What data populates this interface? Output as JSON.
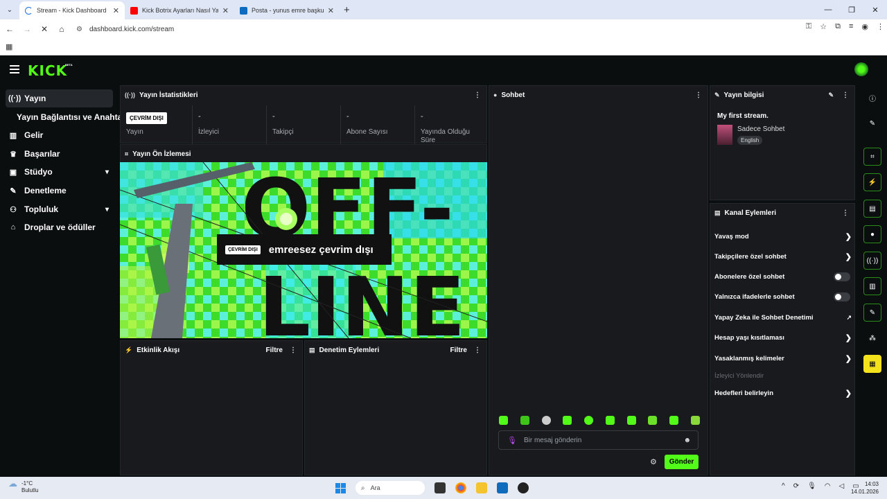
{
  "browser": {
    "tabs": [
      {
        "title": "Stream - Kick Dashboard",
        "active": true
      },
      {
        "title": "Kick Botrix Ayarları Nasıl Yapılır",
        "active": false
      },
      {
        "title": "Posta - yunus emre başkurt - O",
        "active": false
      }
    ],
    "url": "dashboard.kick.com/stream"
  },
  "header": {
    "logo": "KICK",
    "beta": "BETA"
  },
  "sidebar": {
    "items": [
      {
        "label": "Yayın",
        "icon": "broadcast-icon",
        "active": true
      },
      {
        "label": "Yayın Bağlantısı ve Anahtarı",
        "sub": true
      },
      {
        "label": "Gelir",
        "icon": "chart-icon"
      },
      {
        "label": "Başarılar",
        "icon": "trophy-icon"
      },
      {
        "label": "Stüdyo",
        "icon": "studio-icon",
        "expandable": true
      },
      {
        "label": "Denetleme",
        "icon": "wrench-icon"
      },
      {
        "label": "Topluluk",
        "icon": "people-icon",
        "expandable": true
      },
      {
        "label": "Droplar ve ödüller",
        "icon": "gift-icon"
      }
    ]
  },
  "stats": {
    "title": "Yayın İstatistikleri",
    "offline_badge": "ÇEVRİM DIŞI",
    "items": [
      {
        "value": "",
        "label": "Yayın"
      },
      {
        "value": "-",
        "label": "İzleyici"
      },
      {
        "value": "-",
        "label": "Takipçi"
      },
      {
        "value": "-",
        "label": "Abone Sayısı"
      },
      {
        "value": "-",
        "label": "Yayında Olduğu Süre"
      }
    ]
  },
  "preview": {
    "title": "Yayın Ön İzlemesi",
    "offline_tag": "ÇEVRİM DIŞI",
    "offline_msg": "emreesez çevrim dışı",
    "art_text_1": "OFF-",
    "art_text_2": "LINE"
  },
  "activity": {
    "title": "Etkinlik Akışı",
    "filter": "Filtre"
  },
  "modactions": {
    "title": "Denetim Eylemleri",
    "filter": "Filtre"
  },
  "chat": {
    "title": "Sohbet",
    "placeholder": "Bir mesaj gönderin",
    "send": "Gönder"
  },
  "streaminfo": {
    "title": "Yayın bilgisi",
    "stream_title": "My first stream.",
    "category": "Sadece Sohbet",
    "language": "English"
  },
  "channel_actions": {
    "title": "Kanal Eylemleri",
    "items": [
      {
        "label": "Yavaş mod",
        "control": "chevron"
      },
      {
        "label": "Takipçilere özel sohbet",
        "control": "chevron"
      },
      {
        "label": "Abonelere özel sohbet",
        "control": "toggle"
      },
      {
        "label": "Yalnızca ifadelerle sohbet",
        "control": "toggle"
      },
      {
        "label": "Yapay Zeka ile Sohbet Denetimi",
        "control": "external"
      },
      {
        "label": "Hesap yaşı kısıtlaması",
        "control": "chevron"
      },
      {
        "label": "Yasaklanmış kelimeler",
        "control": "chevron"
      },
      {
        "label": "İzleyici Yönlendir",
        "control": "none",
        "disabled": true
      },
      {
        "label": "Hedefleri belirleyin",
        "control": "chevron"
      }
    ]
  },
  "taskbar": {
    "temp": "-1°C",
    "weather": "Bulutlu",
    "search": "Ara",
    "time": "14:03",
    "date": "14.01.2026"
  },
  "colors": {
    "accent": "#53fc18",
    "panel": "#181a1e",
    "bg": "#0b0e0f"
  }
}
